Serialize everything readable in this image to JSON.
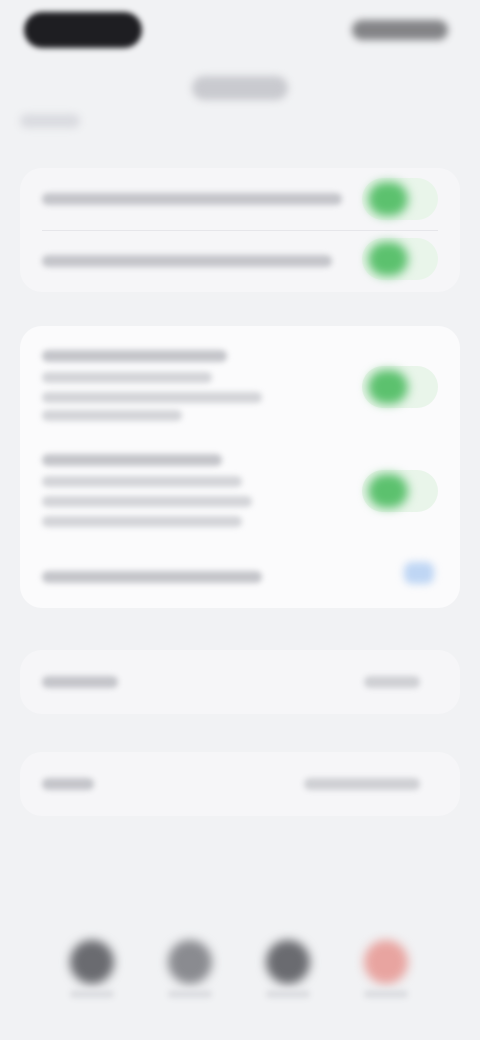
{
  "status_bar": {
    "left_indicator_icon": "dynamic-island-pill",
    "right_indicators_icon": "signal-wifi-battery"
  },
  "header": {
    "title": ""
  },
  "group_1": {
    "rows": [
      {
        "label": "",
        "toggle_on": true
      },
      {
        "label": "",
        "toggle_on": true
      }
    ]
  },
  "group_2": {
    "rows": [
      {
        "label": "",
        "description": "",
        "toggle_on": true
      },
      {
        "label": "",
        "description": "",
        "toggle_on": true
      },
      {
        "label": "",
        "checked": true
      }
    ]
  },
  "group_3": {
    "label": "",
    "value": ""
  },
  "group_4": {
    "label": "",
    "value": ""
  },
  "action_bar": {
    "buttons": [
      {
        "icon": "circle-button-icon",
        "color": "#6a6b70"
      },
      {
        "icon": "circle-button-icon",
        "color": "#8a8b90"
      },
      {
        "icon": "circle-button-icon",
        "color": "#6a6b70"
      },
      {
        "icon": "circle-button-icon",
        "color": "#e8a4a0"
      }
    ]
  },
  "colors": {
    "background": "#f1f2f4",
    "card": "#f6f6f8",
    "toggle_on": "#5cc16e",
    "accent_blue": "#bfd6f4",
    "destructive": "#e8a4a0"
  }
}
